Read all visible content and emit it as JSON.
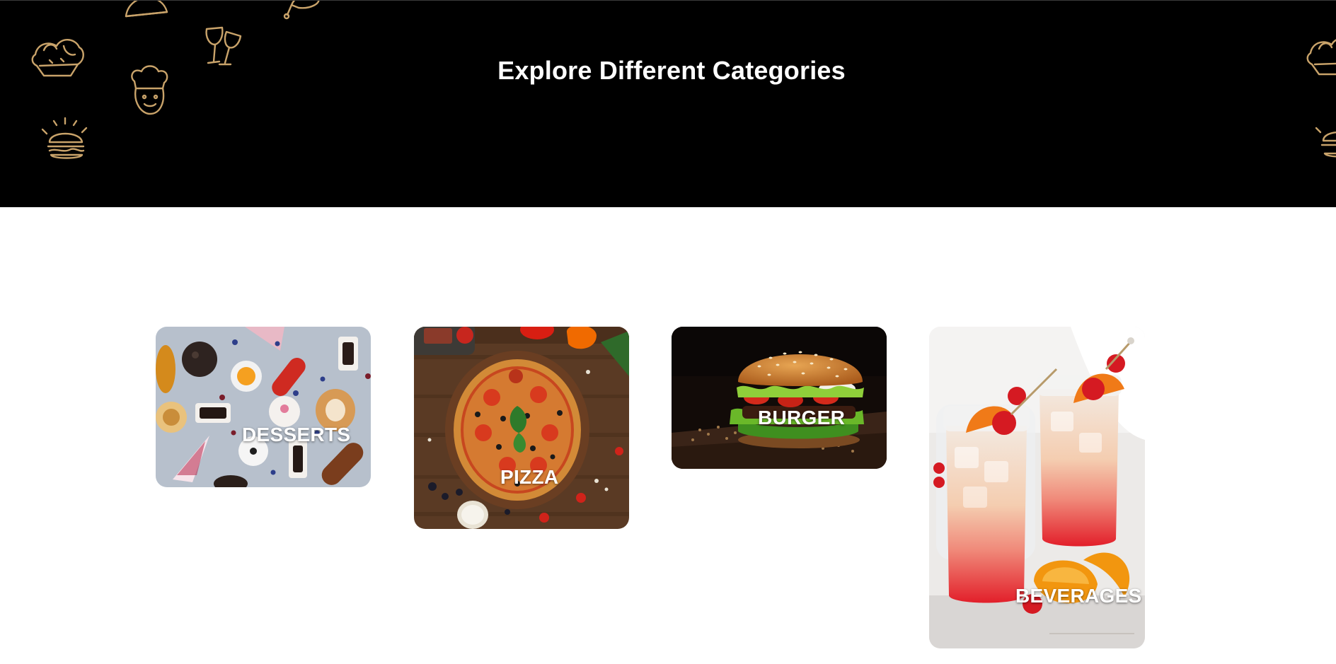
{
  "hero": {
    "title": "Explore Different Categories",
    "background": "#000000",
    "doodle_color": "#c9a36a",
    "doodles": [
      "taco-icon",
      "bread-basket-icon",
      "wine-glasses-icon",
      "chef-icon",
      "burger-icon",
      "drumstick-icon"
    ]
  },
  "categories": [
    {
      "label": "DESSERTS"
    },
    {
      "label": "PIZZA"
    },
    {
      "label": "BURGER"
    },
    {
      "label": "BEVERAGES"
    }
  ]
}
